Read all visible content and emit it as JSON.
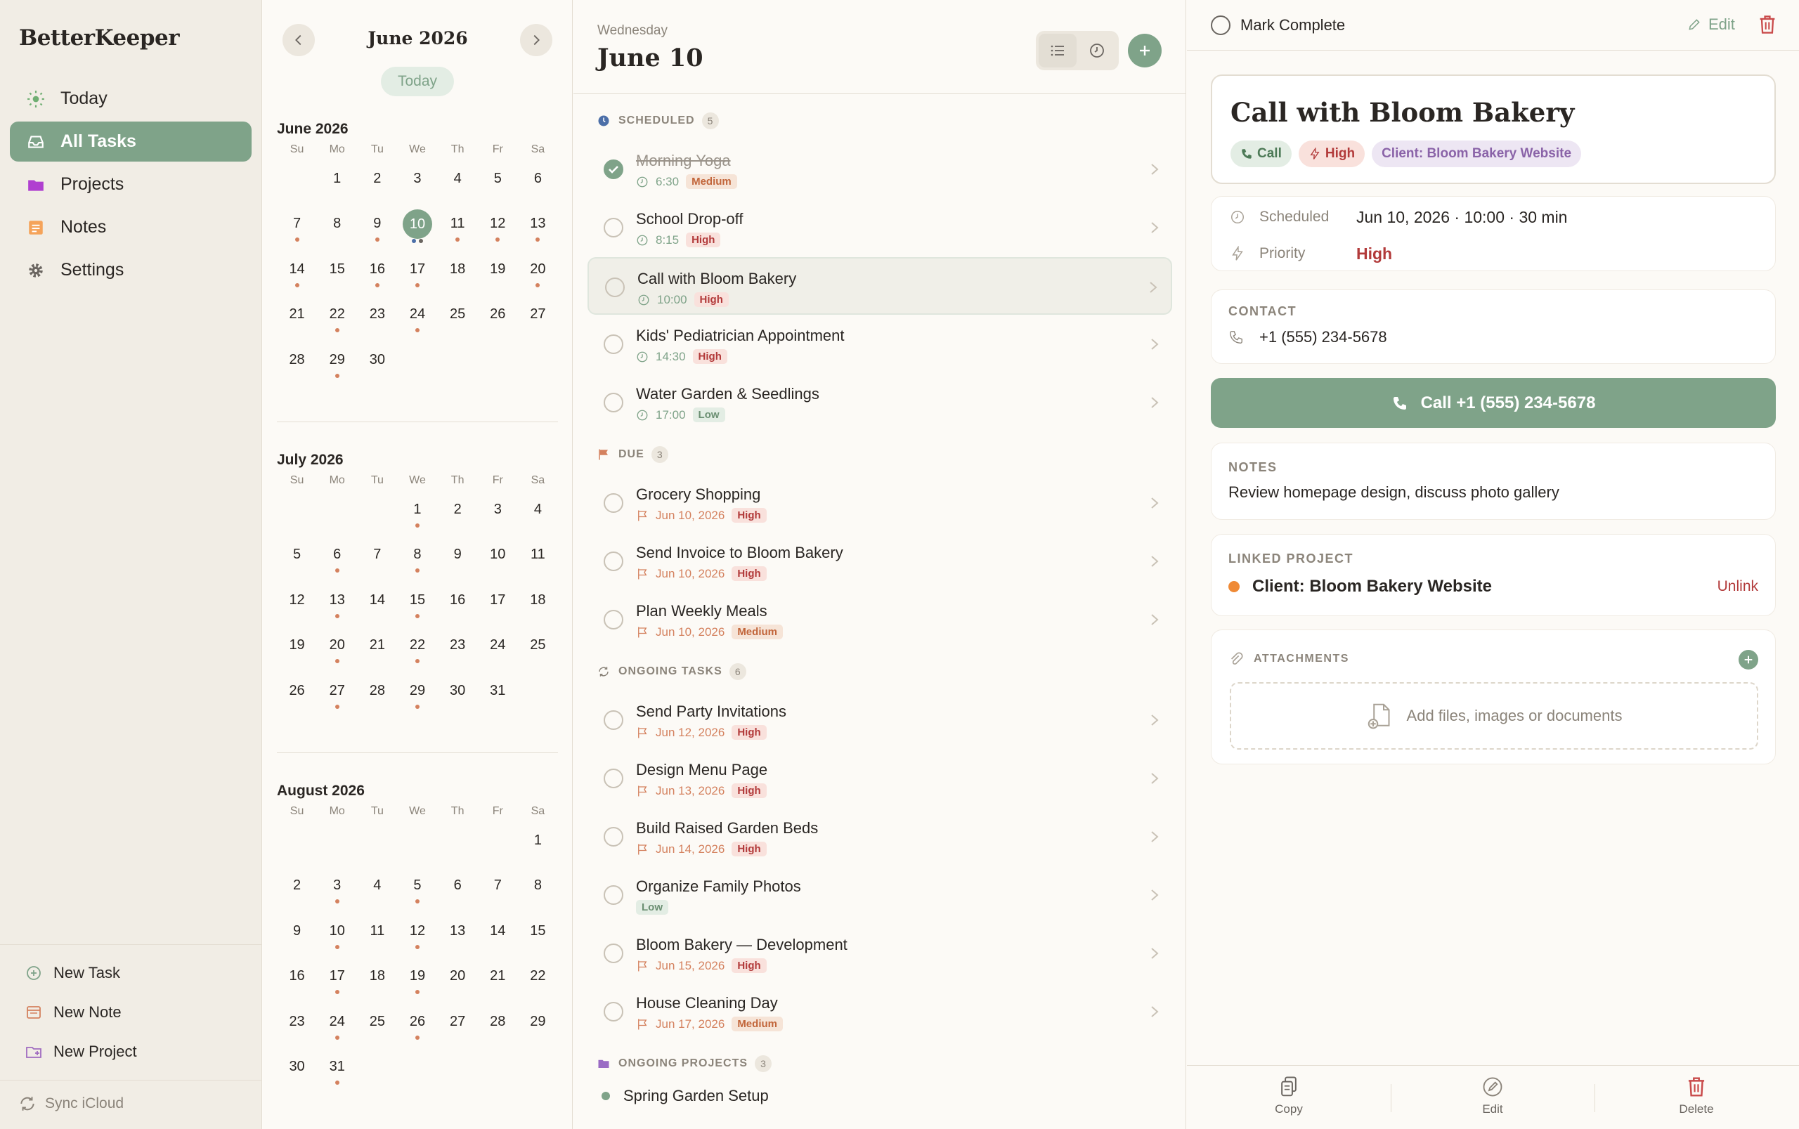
{
  "app": {
    "title": "BetterKeeper"
  },
  "sidebar": {
    "items": [
      {
        "label": "Today",
        "icon": "sun-icon"
      },
      {
        "label": "All Tasks",
        "icon": "inbox-icon"
      },
      {
        "label": "Projects",
        "icon": "folder-icon"
      },
      {
        "label": "Notes",
        "icon": "note-icon"
      },
      {
        "label": "Settings",
        "icon": "gear-icon"
      }
    ],
    "actions": [
      {
        "label": "New Task",
        "icon": "plus-circle-icon"
      },
      {
        "label": "New Note",
        "icon": "note-icon"
      },
      {
        "label": "New Project",
        "icon": "folder-plus-icon"
      }
    ],
    "sync_label": "Sync iCloud"
  },
  "calendar": {
    "title": "June 2026",
    "today_label": "Today",
    "weekdays": [
      "Su",
      "Mo",
      "Tu",
      "We",
      "Th",
      "Fr",
      "Sa"
    ],
    "months": [
      {
        "name": "June 2026",
        "offset": 1,
        "days": 30,
        "selected": 10,
        "dots": {
          "7": 1,
          "9": 1,
          "10": 2,
          "11": 1,
          "12": 1,
          "13": 1,
          "14": 1,
          "16": 1,
          "17": 1,
          "20": 1,
          "22": 1,
          "24": 1,
          "29": 1
        }
      },
      {
        "name": "July 2026",
        "offset": 3,
        "days": 31,
        "selected": 0,
        "dots": {
          "1": 1,
          "6": 1,
          "8": 1,
          "13": 1,
          "15": 1,
          "20": 1,
          "22": 1,
          "27": 1,
          "29": 1
        }
      },
      {
        "name": "August 2026",
        "offset": 6,
        "days": 31,
        "selected": 0,
        "dots": {
          "3": 1,
          "5": 1,
          "10": 1,
          "12": 1,
          "17": 1,
          "19": 1,
          "24": 1,
          "26": 1,
          "31": 1
        }
      }
    ]
  },
  "tasks_panel": {
    "weekday": "Wednesday",
    "date_title": "June 10",
    "sections": [
      {
        "label": "SCHEDULED",
        "count": "5",
        "icon": "clock-icon",
        "tasks": [
          {
            "name": "Morning Yoga",
            "meta": "6:30",
            "priority": "Medium",
            "done": true,
            "kind": "time"
          },
          {
            "name": "School Drop-off",
            "meta": "8:15",
            "priority": "High",
            "kind": "time"
          },
          {
            "name": "Call with Bloom Bakery",
            "meta": "10:00",
            "priority": "High",
            "kind": "time",
            "active": true
          },
          {
            "name": "Kids' Pediatrician Appointment",
            "meta": "14:30",
            "priority": "High",
            "kind": "time"
          },
          {
            "name": "Water Garden & Seedlings",
            "meta": "17:00",
            "priority": "Low",
            "kind": "time"
          }
        ]
      },
      {
        "label": "DUE",
        "count": "3",
        "icon": "flag-icon",
        "tasks": [
          {
            "name": "Grocery Shopping",
            "meta": "Jun 10, 2026",
            "priority": "High",
            "kind": "due"
          },
          {
            "name": "Send Invoice to Bloom Bakery",
            "meta": "Jun 10, 2026",
            "priority": "High",
            "kind": "due"
          },
          {
            "name": "Plan Weekly Meals",
            "meta": "Jun 10, 2026",
            "priority": "Medium",
            "kind": "due"
          }
        ]
      },
      {
        "label": "ONGOING TASKS",
        "count": "6",
        "icon": "refresh-icon",
        "tasks": [
          {
            "name": "Send Party Invitations",
            "meta": "Jun 12, 2026",
            "priority": "High",
            "kind": "due"
          },
          {
            "name": "Design Menu Page",
            "meta": "Jun 13, 2026",
            "priority": "High",
            "kind": "due"
          },
          {
            "name": "Build Raised Garden Beds",
            "meta": "Jun 14, 2026",
            "priority": "High",
            "kind": "due"
          },
          {
            "name": "Organize Family Photos",
            "meta": "",
            "priority": "Low",
            "kind": "none"
          },
          {
            "name": "Bloom Bakery — Development",
            "meta": "Jun 15, 2026",
            "priority": "High",
            "kind": "due"
          },
          {
            "name": "House Cleaning Day",
            "meta": "Jun 17, 2026",
            "priority": "Medium",
            "kind": "due"
          }
        ]
      },
      {
        "label": "ONGOING PROJECTS",
        "count": "3",
        "icon": "folder-icon",
        "projects": [
          {
            "name": "Spring Garden Setup"
          }
        ]
      }
    ]
  },
  "detail": {
    "mark_complete": "Mark Complete",
    "edit_label": "Edit",
    "title": "Call with Bloom Bakery",
    "chips": {
      "type": "Call",
      "priority": "High",
      "project": "Client: Bloom Bakery Website"
    },
    "scheduled_label": "Scheduled",
    "scheduled_value": "Jun 10, 2026 · 10:00 · 30 min",
    "priority_label": "Priority",
    "priority_value": "High",
    "contact_label": "CONTACT",
    "contact_phone": "+1 (555) 234-5678",
    "call_button": "Call +1 (555) 234-5678",
    "notes_label": "NOTES",
    "notes_text": "Review homepage design, discuss photo gallery",
    "linked_label": "LINKED PROJECT",
    "linked_project": "Client: Bloom Bakery Website",
    "unlink_label": "Unlink",
    "attachments_label": "ATTACHMENTS",
    "attach_placeholder": "Add files, images or documents",
    "bottom": {
      "copy": "Copy",
      "edit": "Edit",
      "delete": "Delete"
    }
  },
  "colors": {
    "accent": "#7fa389",
    "danger": "#b23a3a",
    "project_orange": "#ef8a36",
    "dot": "#d4815e"
  }
}
